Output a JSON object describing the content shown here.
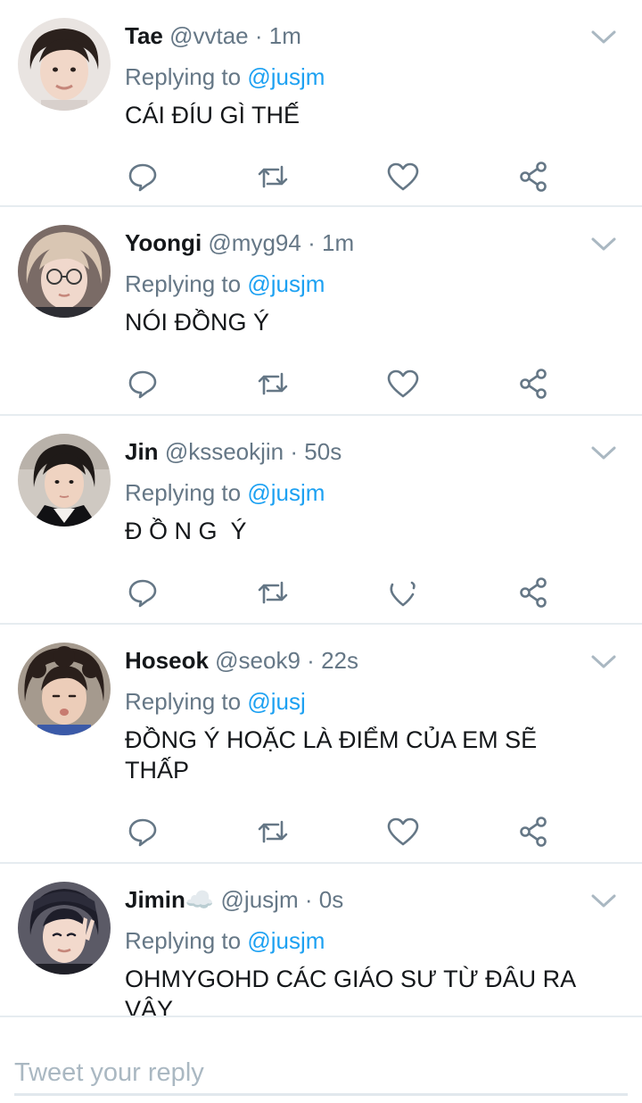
{
  "tweets": [
    {
      "name": "Tae",
      "handle": "@vvtae",
      "separator": "·",
      "time": "1m",
      "replying_prefix": "Replying to",
      "replying_to": "@jusjm",
      "text": "CÁI ĐÍU GÌ THẾ"
    },
    {
      "name": "Yoongi",
      "handle": "@myg94",
      "separator": "·",
      "time": "1m",
      "replying_prefix": "Replying to",
      "replying_to": "@jusjm",
      "text": "NÓI ĐỒNG Ý"
    },
    {
      "name": "Jin",
      "handle": "@ksseokjin",
      "separator": "·",
      "time": "50s",
      "replying_prefix": "Replying to",
      "replying_to": "@jusjm",
      "text": "Đ Ồ N G  Ý"
    },
    {
      "name": "Hoseok",
      "handle": "@seok9",
      "separator": "·",
      "time": "22s",
      "replying_prefix": "Replying to",
      "replying_to": "@jusj",
      "text": "ĐỒNG Ý HOẶC LÀ ĐIỂM CỦA EM SẼ THẤP"
    },
    {
      "name": "Jimin",
      "name_emoji": "☁️",
      "handle": "@jusjm",
      "separator": "·",
      "time": "0s",
      "replying_prefix": "Replying to",
      "replying_to": "@jusjm",
      "text": "OHMYGOHD CÁC GIÁO SƯ TỪ ĐÂU RA VẬY"
    }
  ],
  "icons": {
    "menu": "chevron-down-icon",
    "reply": "reply-icon",
    "retweet": "retweet-icon",
    "like": "heart-icon",
    "share": "share-icon"
  },
  "composer": {
    "placeholder": "Tweet your reply"
  },
  "colors": {
    "link": "#1da1f2",
    "secondary_text": "#657786",
    "icon": "#657786",
    "divider": "#e6ecf0",
    "placeholder": "#aab8c2"
  }
}
